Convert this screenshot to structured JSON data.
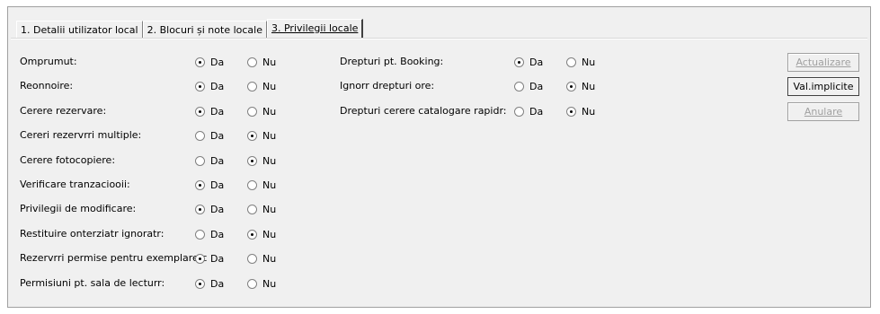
{
  "tabs": [
    {
      "label": "1. Detalii utilizator local",
      "active": false
    },
    {
      "label": "2. Blocuri și note locale",
      "active": false
    },
    {
      "label": "3. Privilegii locale",
      "active": true
    }
  ],
  "left_rows": [
    {
      "label": "Omprumut:",
      "da_label": "Da",
      "nu_label": "Nu",
      "value": "Da"
    },
    {
      "label": "Reonnoire:",
      "da_label": "Da",
      "nu_label": "Nu",
      "value": "Da"
    },
    {
      "label": "Cerere rezervare:",
      "da_label": "Da",
      "nu_label": "Nu",
      "value": "Da"
    },
    {
      "label": "Cereri rezervrri multiple:",
      "da_label": "Da",
      "nu_label": "Nu",
      "value": "Nu"
    },
    {
      "label": "Cerere fotocopiere:",
      "da_label": "Da",
      "nu_label": "Nu",
      "value": "Nu"
    },
    {
      "label": "Verificare tranzaciooii:",
      "da_label": "Da",
      "nu_label": "Nu",
      "value": "Da"
    },
    {
      "label": "Privilegii de modificare:",
      "da_label": "Da",
      "nu_label": "Nu",
      "value": "Da"
    },
    {
      "label": "Restituire onterziatr ignoratr:",
      "da_label": "Da",
      "nu_label": "Nu",
      "value": "Nu"
    },
    {
      "label": "Rezervrri permise pentru exemplare c",
      "da_label": "Da",
      "nu_label": "Nu",
      "value": "Da"
    },
    {
      "label": "Permisiuni pt. sala de lecturr:",
      "da_label": "Da",
      "nu_label": "Nu",
      "value": "Da"
    }
  ],
  "right_rows": [
    {
      "label": "Drepturi pt. Booking:",
      "da_label": "Da",
      "nu_label": "Nu",
      "value": "Da"
    },
    {
      "label": "Ignorr drepturi ore:",
      "da_label": "Da",
      "nu_label": "Nu",
      "value": "Nu"
    },
    {
      "label": "Drepturi cerere catalogare rapidr:",
      "da_label": "Da",
      "nu_label": "Nu",
      "value": "Nu"
    }
  ],
  "buttons": {
    "update": "Actualizare",
    "defaults": "Val.implicite",
    "cancel": "Anulare"
  }
}
